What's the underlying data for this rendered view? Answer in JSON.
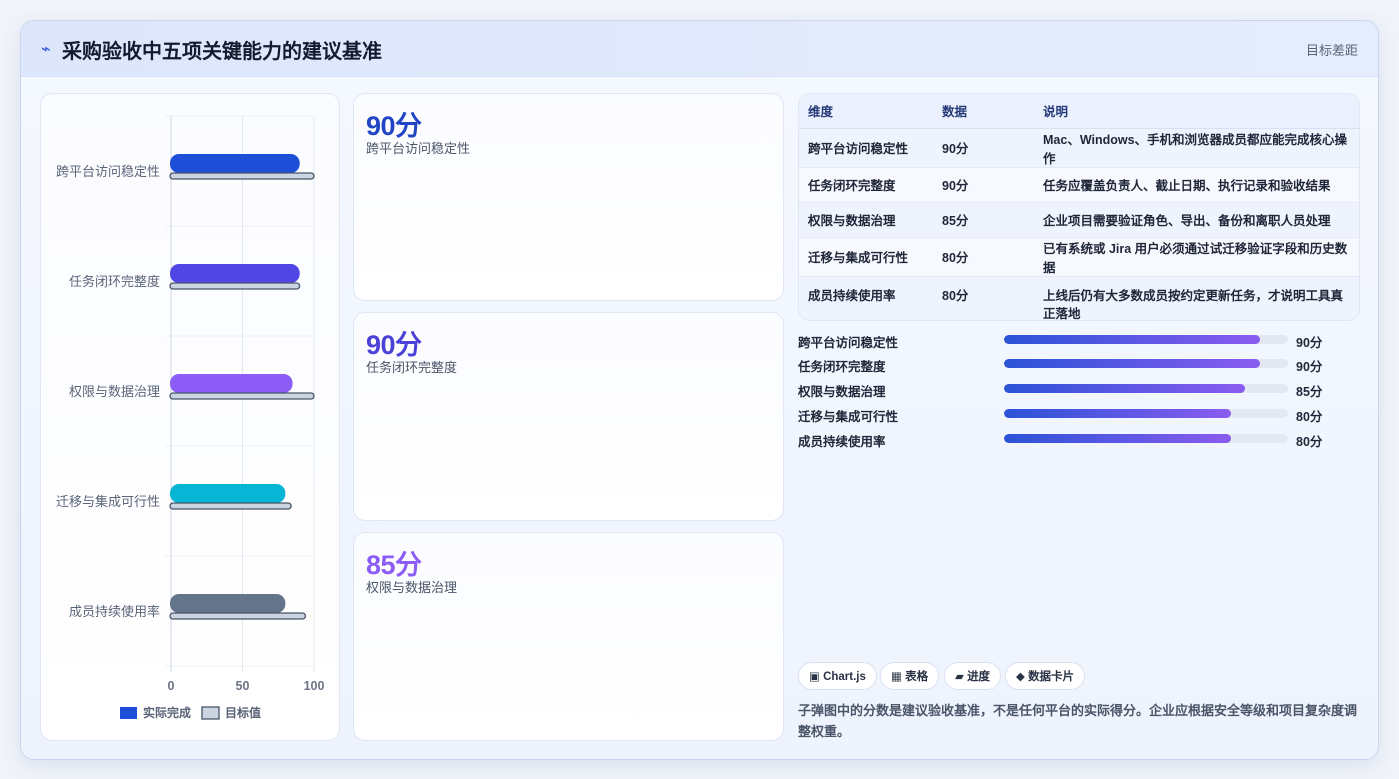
{
  "header": {
    "icon": "bolt-icon",
    "title": "采购验收中五项关键能力的建议基准",
    "right_text": "目标差距"
  },
  "chart_data": {
    "type": "bar",
    "orientation": "horizontal",
    "categories": [
      "跨平台访问稳定性",
      "任务闭环完整度",
      "权限与数据治理",
      "迁移与集成可行性",
      "成员持续使用率"
    ],
    "series": [
      {
        "name": "实际完成",
        "values": [
          90,
          90,
          85,
          80,
          80
        ],
        "colors": [
          "#1d4ed8",
          "#4f46e5",
          "#8b5cf6",
          "#06b6d4",
          "#64748b"
        ]
      },
      {
        "name": "目标值",
        "values": [
          100,
          90,
          100,
          84,
          94
        ],
        "color": "#cbd5e1",
        "stroke": "#475569"
      }
    ],
    "xlim": [
      0,
      100
    ],
    "xticks": [
      "0",
      "50",
      "100"
    ],
    "grid": true,
    "legend": "bottom"
  },
  "kpis": [
    {
      "value": "90分",
      "label": "跨平台访问稳定性",
      "color": "#2145c4"
    },
    {
      "value": "90分",
      "label": "任务闭环完整度",
      "color": "#4b40d8"
    },
    {
      "value": "85分",
      "label": "权限与数据治理",
      "color": "#8b5cf6"
    }
  ],
  "table": {
    "headers": [
      "维度",
      "数据",
      "说明"
    ],
    "rows": [
      [
        "跨平台访问稳定性",
        "90分",
        "Mac、Windows、手机和浏览器成员都应能完成核心操作"
      ],
      [
        "任务闭环完整度",
        "90分",
        "任务应覆盖负责人、截止日期、执行记录和验收结果"
      ],
      [
        "权限与数据治理",
        "85分",
        "企业项目需要验证角色、导出、备份和离职人员处理"
      ],
      [
        "迁移与集成可行性",
        "80分",
        "已有系统或 Jira 用户必须通过试迁移验证字段和历史数据"
      ],
      [
        "成员持续使用率",
        "80分",
        "上线后仍有大多数成员按约定更新任务，才说明工具真正落地"
      ]
    ]
  },
  "progress": [
    {
      "label": "跨平台访问稳定性",
      "value": 90,
      "text": "90分"
    },
    {
      "label": "任务闭环完整度",
      "value": 90,
      "text": "90分"
    },
    {
      "label": "权限与数据治理",
      "value": 85,
      "text": "85分"
    },
    {
      "label": "迁移与集成可行性",
      "value": 80,
      "text": "80分"
    },
    {
      "label": "成员持续使用率",
      "value": 80,
      "text": "80分"
    }
  ],
  "tags": [
    {
      "icon": "chart-square-icon",
      "glyph": "▣",
      "label": "Chart.js"
    },
    {
      "icon": "table-grid-icon",
      "glyph": "▦",
      "label": "表格"
    },
    {
      "icon": "progress-icon",
      "glyph": "▰",
      "label": "进度"
    },
    {
      "icon": "diamond-icon",
      "glyph": "◆",
      "label": "数据卡片"
    }
  ],
  "note": "子弹图中的分数是建议验收基准，不是任何平台的实际得分。企业应根据安全等级和项目复杂度调整权重。"
}
